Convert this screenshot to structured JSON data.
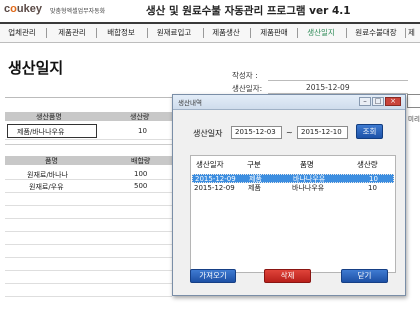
{
  "header": {
    "logo": "coukey",
    "tagline": "맞춤형엑셀업무자동화",
    "app_title": "생산 및 원료수불 자동관리 프로그램 ver 4.1"
  },
  "nav": {
    "items": [
      "업체관리",
      "제품관리",
      "배합정보",
      "원재료입고",
      "제품생산",
      "제품판매",
      "생산일지",
      "원료수불대장",
      "제"
    ],
    "active_index": 6
  },
  "page": {
    "title": "생산일지",
    "author_label": "작성자 :",
    "author_value": "",
    "date_label": "생산일자:",
    "date_value": "2015-12-09"
  },
  "product_table": {
    "headers": [
      "생산품명",
      "생산량"
    ],
    "rows": [
      [
        "제품/바나나우유",
        "10"
      ]
    ]
  },
  "material_table": {
    "headers": [
      "품명",
      "배합량"
    ],
    "rows": [
      [
        "원재료/바나나",
        "100"
      ],
      [
        "원재료/우유",
        "500"
      ]
    ]
  },
  "dialog": {
    "title": "생산내역",
    "period_label": "생산일자",
    "date_from": "2015-12-03",
    "separator": "~",
    "date_to": "2015-12-10",
    "search_label": "조회",
    "list_headers": [
      "생산일자",
      "구분",
      "품명",
      "생산량"
    ],
    "list_rows": [
      {
        "date": "2015-12-09",
        "type": "제품",
        "name": "바나나우유",
        "qty": "10",
        "selected": true
      },
      {
        "date": "2015-12-09",
        "type": "제품",
        "name": "바나나우유",
        "qty": "10",
        "selected": false
      }
    ],
    "buttons": {
      "fetch": "가져오기",
      "delete": "삭제",
      "close": "닫기"
    },
    "window_controls": {
      "minimize": "–",
      "maximize": "□",
      "close": "×"
    }
  },
  "right_edge_label": "미리",
  "colors": {
    "active_nav": "#2e8b57",
    "selected_row": "#3d8ee0",
    "primary_button": "#2a63bd",
    "delete_button": "#cc2f28",
    "logo_accent": "#e06a1a"
  }
}
